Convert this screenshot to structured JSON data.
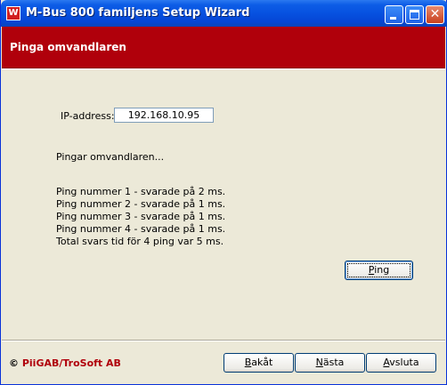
{
  "window": {
    "title": "M-Bus 800 familjens Setup Wizard",
    "icon_letter": "W",
    "close_glyph": "✕"
  },
  "header": {
    "title": "Pinga omvandlaren",
    "band_color": "#B0000B"
  },
  "form": {
    "ip_label": "IP-address:",
    "ip_value": "192.168.10.95"
  },
  "status_text": "Pingar omvandlaren...",
  "results": [
    "Ping nummer 1 - svarade på 2 ms.",
    "Ping nummer 2 - svarade på 1 ms.",
    "Ping nummer 3 - svarade på 1 ms.",
    "Ping nummer 4 - svarade på 1 ms."
  ],
  "total_text": "Total svars tid för 4 ping var 5 ms.",
  "buttons": {
    "ping_mnemonic": "P",
    "ping_rest": "ing",
    "back_mnemonic": "B",
    "back_rest": "akåt",
    "next_mnemonic": "N",
    "next_rest": "ästa",
    "exit_mnemonic": "A",
    "exit_rest": "vsluta"
  },
  "footer": {
    "copyright_symbol": "©",
    "company": "PiiGAB/TroSoft AB"
  }
}
